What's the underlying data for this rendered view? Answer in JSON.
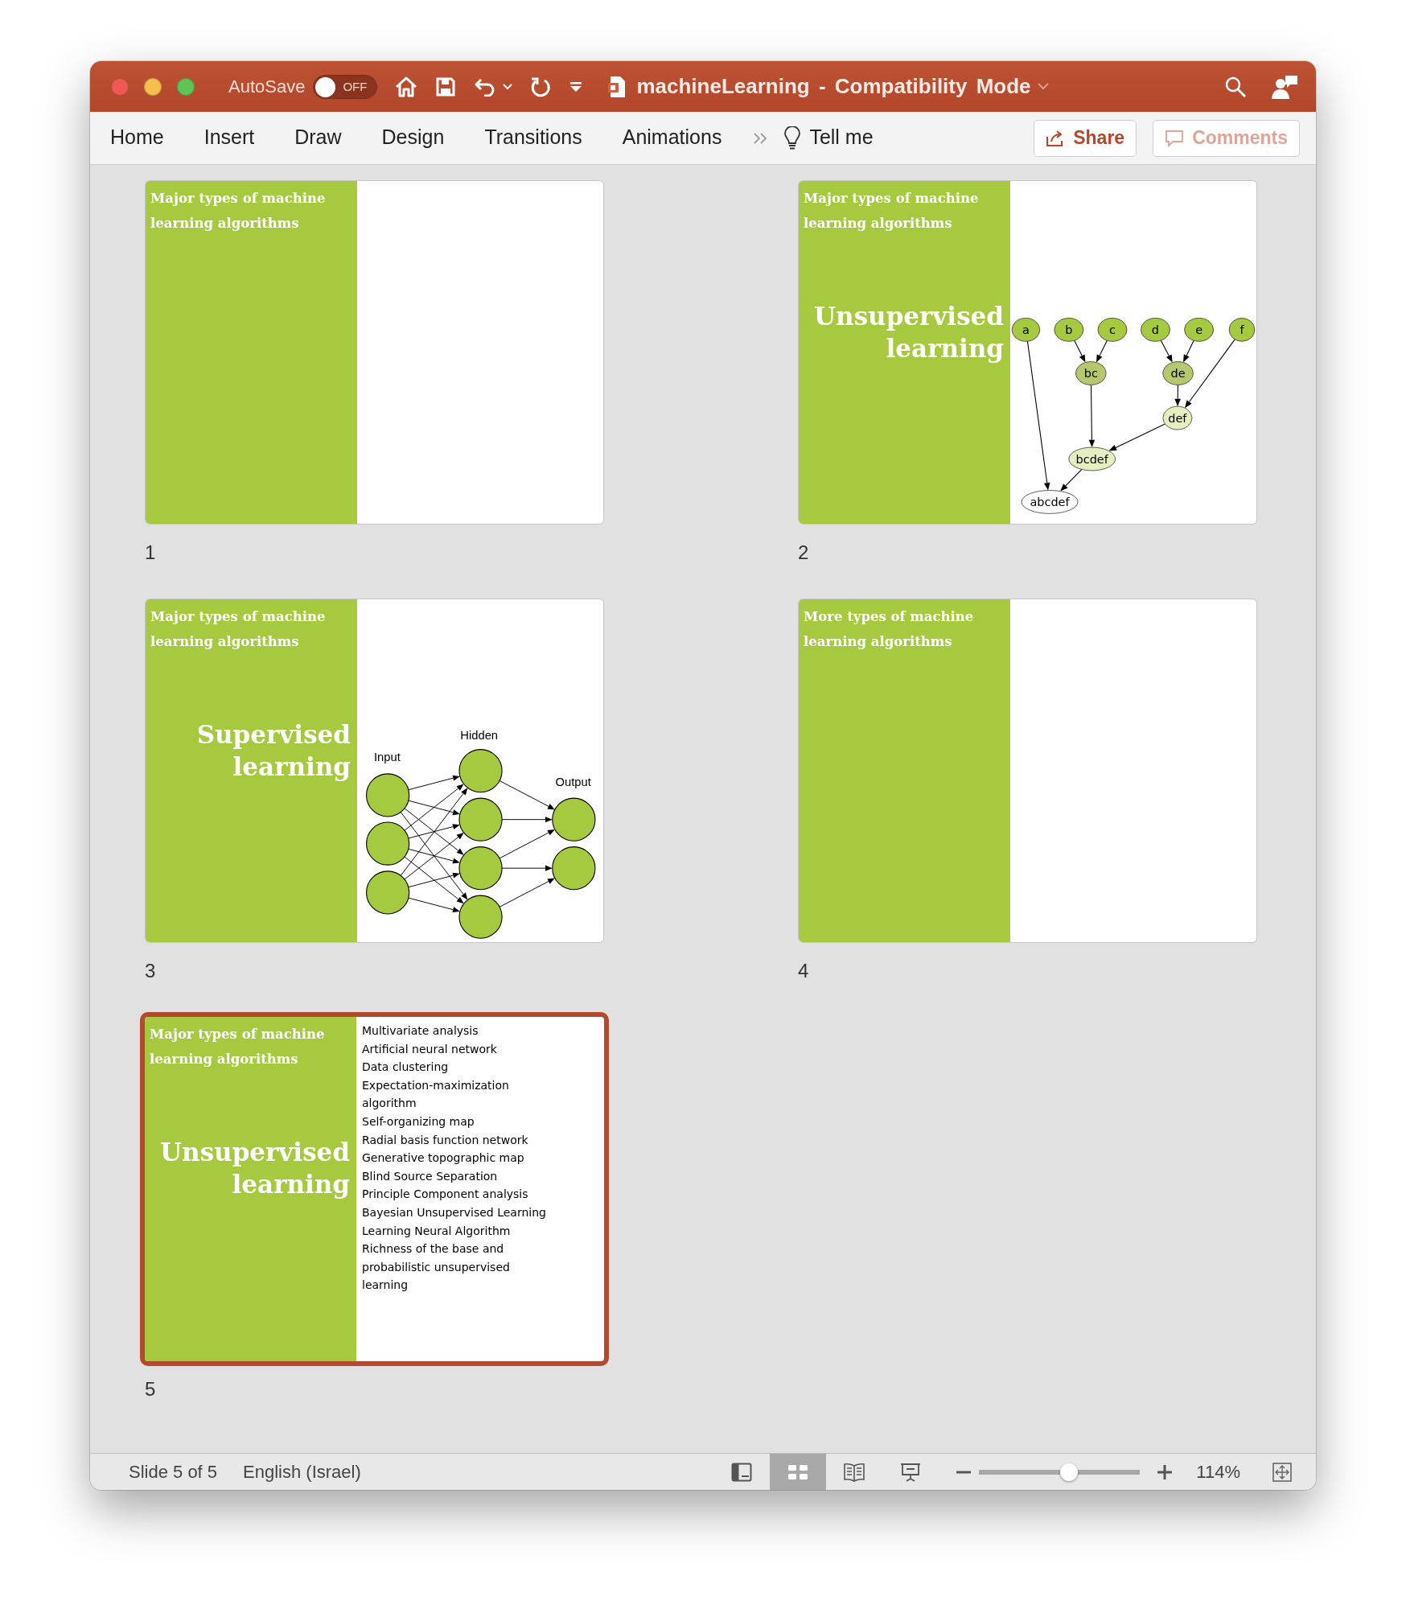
{
  "title_bar": {
    "autosave": {
      "label": "AutoSave",
      "on": false,
      "state_label": "OFF"
    },
    "document_title": "machineLearning - Compatibility Mode"
  },
  "ribbon": {
    "tabs": [
      {
        "label": "Home",
        "selected": false
      },
      {
        "label": "Insert",
        "selected": false
      },
      {
        "label": "Draw",
        "selected": false
      },
      {
        "label": "Design",
        "selected": false
      },
      {
        "label": "Transitions",
        "selected": false
      },
      {
        "label": "Animations",
        "selected": false
      }
    ],
    "tell_me": "Tell me",
    "buttons": [
      {
        "kind": "share",
        "label": "Share",
        "disabled": false
      },
      {
        "kind": "comments",
        "label": "Comments",
        "disabled": true
      }
    ]
  },
  "slides": [
    {
      "number": "1",
      "selected": false,
      "title": "Major types of machine learning algorithms"
    },
    {
      "number": "2",
      "selected": false,
      "title": "Major types of machine learning algorithms",
      "heading": "Unsupervised learning",
      "diagram": {
        "kind": "tree",
        "nodes": [
          {
            "label": "a",
            "color": "#a5c93f"
          },
          {
            "label": "b",
            "color": "#a5c93f"
          },
          {
            "label": "c",
            "color": "#a5c93f"
          },
          {
            "label": "d",
            "color": "#a5c93f"
          },
          {
            "label": "e",
            "color": "#a5c93f"
          },
          {
            "label": "f",
            "color": "#a5c93f"
          },
          {
            "label": "bc",
            "color": "#b6c86e"
          },
          {
            "label": "de",
            "color": "#b6c86e"
          },
          {
            "label": "def",
            "color": "#e4eebe"
          },
          {
            "label": "bcdef",
            "color": "#e4eebe"
          },
          {
            "label": "abcdef",
            "color": "#ffffff"
          }
        ]
      }
    },
    {
      "number": "3",
      "selected": false,
      "title": "Major types of machine learning algorithms",
      "heading": "Supervised learning",
      "diagram": {
        "kind": "network",
        "labels": [
          "Input",
          "Hidden",
          "Output"
        ]
      }
    },
    {
      "number": "4",
      "selected": false,
      "title": "More types of machine learning algorithms"
    },
    {
      "number": "5",
      "selected": true,
      "title": "Major types of machine learning algorithms",
      "heading": "Unsupervised learning",
      "bullets": [
        "Multivariate analysis",
        "Artificial neural network",
        "Data clustering",
        "Expectation-maximization algorithm",
        "Self-organizing map",
        "Radial basis function network",
        "Generative topographic map",
        "Blind Source Separation",
        "Principle Component analysis",
        "Bayesian Unsupervised Learning",
        "Learning Neural Algorithm",
        "Richness of the base and probabilistic unsupervised learning"
      ]
    }
  ],
  "status_bar": {
    "slide_info": "Slide 5 of 5",
    "language": "English (Israel)",
    "views": [
      {
        "kind": "normal",
        "selected": false
      },
      {
        "kind": "sorter",
        "selected": true
      },
      {
        "kind": "reading",
        "selected": false
      },
      {
        "kind": "slideshow",
        "selected": false
      }
    ],
    "zoom": {
      "level": 0.56,
      "reading": "114%"
    }
  }
}
